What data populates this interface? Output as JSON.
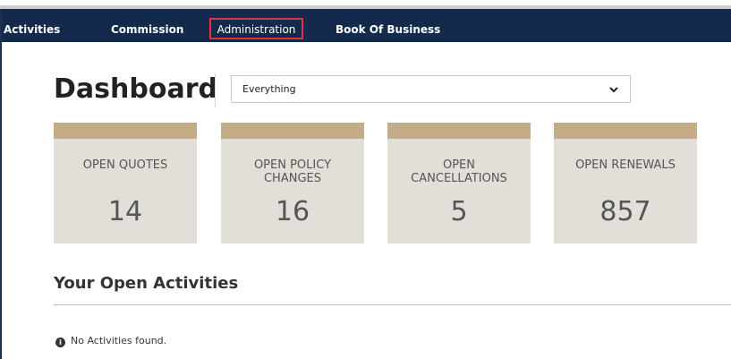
{
  "nav": {
    "items": [
      {
        "label": "Activities"
      },
      {
        "label": "Commission"
      },
      {
        "label": "Administration"
      },
      {
        "label": "Book Of Business"
      }
    ]
  },
  "page": {
    "title": "Dashboard"
  },
  "filter": {
    "selected": "Everything"
  },
  "cards": [
    {
      "label": "OPEN QUOTES",
      "count": "14"
    },
    {
      "label": "OPEN POLICY CHANGES",
      "count": "16"
    },
    {
      "label": "OPEN CANCELLATIONS",
      "count": "5"
    },
    {
      "label": "OPEN RENEWALS",
      "count": "857"
    }
  ],
  "activities": {
    "title": "Your Open Activities",
    "empty_message": "No Activities found."
  },
  "colors": {
    "navbar": "#142a4c",
    "card_band": "#c3ac87",
    "card_bg": "#e2dfd8",
    "highlight": "#e0323a"
  },
  "icons": {
    "select_chevron": "chevron-down-icon",
    "notice": "info-circle-icon"
  }
}
